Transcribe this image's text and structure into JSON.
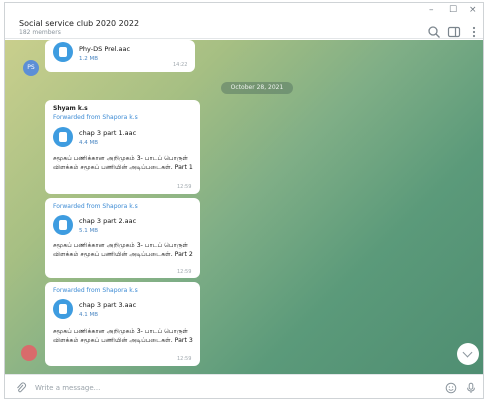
{
  "window": {
    "minimize": "–",
    "maximize": "☐",
    "close": "×"
  },
  "header": {
    "title": "Social service club 2020 2022",
    "subtitle": "182 members"
  },
  "top_message": {
    "file_name": "Phy-DS Prel.aac",
    "file_size": "1.2 MB",
    "time": "14:22",
    "avatar_initials": "PS"
  },
  "date_separator": "October 28, 2021",
  "messages": [
    {
      "sender": "Shyam k.s",
      "forwarded": "Forwarded from Shapora k.s",
      "file_name": "chap 3 part 1.aac",
      "file_size": "4.4 MB",
      "caption": "சமூகப் பணிக்கான அறிமுகம் 3- பாடப் பொருள் விளக்கம் சமூகப் பணியின் அடிப்படைகள். Part 1",
      "time": "12:59"
    },
    {
      "sender": "",
      "forwarded": "Forwarded from Shapora k.s",
      "file_name": "chap 3 part 2.aac",
      "file_size": "5.1 MB",
      "caption": "சமூகப் பணிக்கான அறிமுகம் 3- பாடப் பொருள் விளக்கம் சமூகப் பணியின் அடிப்படைகள். Part 2",
      "time": "12:59"
    },
    {
      "sender": "",
      "forwarded": "Forwarded from Shapora k.s",
      "file_name": "chap 3 part 3.aac",
      "file_size": "4.1 MB",
      "caption": "சமூகப் பணிக்கான அறிமுகம் 3- பாடப் பொருள் விளக்கம் சமூகப் பணியின் அடிப்படைகள். Part 3",
      "time": "12:59"
    }
  ],
  "composer": {
    "placeholder": "Write a message..."
  },
  "icons": {
    "search": "search-icon",
    "sidebar": "sidebar-icon",
    "more": "more-icon",
    "attach": "paperclip-icon",
    "emoji": "emoji-icon",
    "mic": "mic-icon",
    "scroll": "chevron-down-icon"
  },
  "colors": {
    "accent": "#3e9ce0",
    "forward_link": "#3d8bd4"
  }
}
